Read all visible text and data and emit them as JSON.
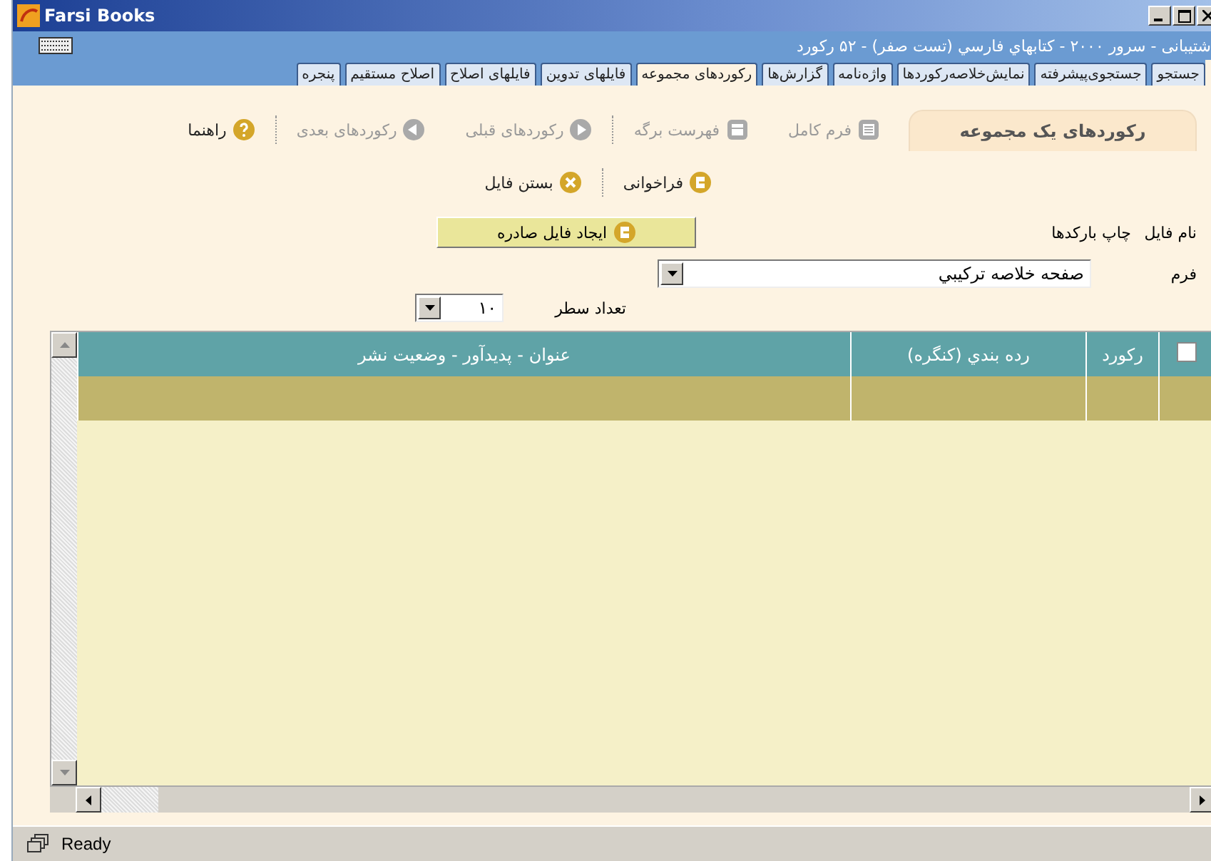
{
  "window": {
    "title": "Farsi Books"
  },
  "info_bar": {
    "text": "شتیبانی - سرور ۲۰۰۰ - کتابهاي فارسي (تست صفر) - ۵۲ رکورد"
  },
  "tabs": [
    {
      "label": "جستجو",
      "selected": false
    },
    {
      "label": "جستجوی‌پیشرفته",
      "selected": false
    },
    {
      "label": "نمایش‌خلاصه‌رکوردها",
      "selected": false
    },
    {
      "label": "واژه‌نامه",
      "selected": false
    },
    {
      "label": "گزارش‌ها",
      "selected": false
    },
    {
      "label": "رکوردهای مجموعه",
      "selected": true
    },
    {
      "label": "فایلهای تدوین",
      "selected": false
    },
    {
      "label": "فایلهای اصلاح",
      "selected": false
    },
    {
      "label": "اصلاح مستقیم",
      "selected": false
    },
    {
      "label": "پنجره",
      "selected": false
    }
  ],
  "panel": {
    "title": "رکوردهای یک مجموعه"
  },
  "toolbar_groups": [
    [
      {
        "label": "فرم کامل",
        "kind": "form",
        "disabled": true
      },
      {
        "label": "فهرست برگه",
        "kind": "list",
        "disabled": true
      }
    ],
    [
      {
        "label": "رکوردهای قبلی",
        "kind": "next",
        "disabled": true
      },
      {
        "label": "رکوردهای بعدی",
        "kind": "prev",
        "disabled": true
      }
    ],
    [
      {
        "label": "راهنما",
        "kind": "help",
        "disabled": false
      }
    ]
  ],
  "file_action_groups": [
    [
      {
        "label": "فراخوانی",
        "kind": "open",
        "disabled": false
      }
    ],
    [
      {
        "label": "بستن فایل",
        "kind": "close",
        "disabled": false
      }
    ]
  ],
  "file_name": {
    "label": "نام فایل",
    "value": "چاپ بارکدها"
  },
  "export_button": {
    "label": "ایجاد فایل صادره",
    "kind": "open"
  },
  "form_field": {
    "label": "فرم",
    "value": "صفحه خلاصه ترکیبي"
  },
  "rows_field": {
    "label": "تعداد سطر",
    "value": "۱۰"
  },
  "table": {
    "header_checked": false,
    "columns": [
      "رکورد",
      "رده بندي (کنگره)",
      "عنوان - پديدآور - وضعيت نشر"
    ],
    "rows": [
      {
        "selected": true
      }
    ]
  },
  "status_bar": {
    "text": "Ready"
  }
}
